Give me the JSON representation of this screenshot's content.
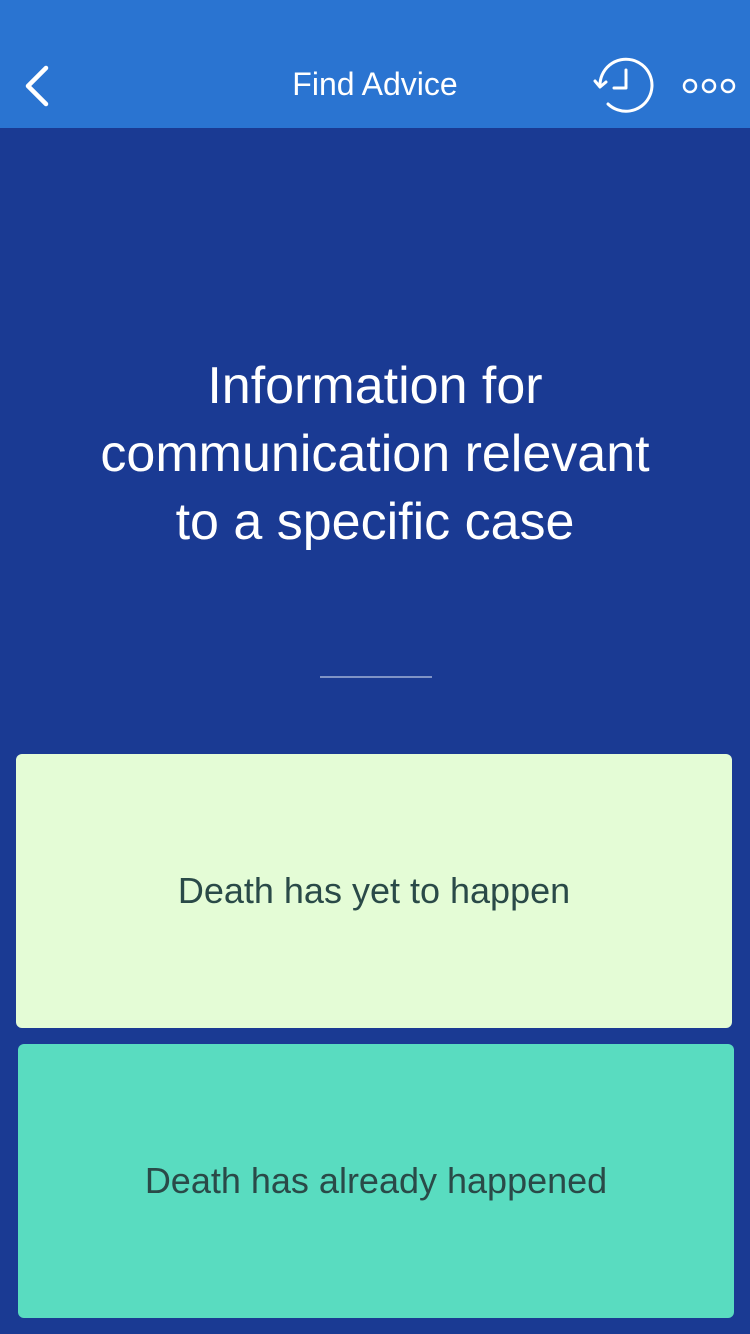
{
  "header": {
    "title": "Find Advice",
    "colors": {
      "background": "#2a74d1",
      "text": "#ffffff"
    },
    "icons": {
      "back": "chevron-left-icon",
      "history": "history-icon",
      "more": "more-dots-icon"
    }
  },
  "main": {
    "background": "#1a3a93",
    "headline": "Information for communication relevant to a specific case",
    "options": [
      {
        "label": "Death has yet to happen",
        "color": "#e4fcd6"
      },
      {
        "label": "Death has already happened",
        "color": "#59dcc0"
      }
    ]
  }
}
